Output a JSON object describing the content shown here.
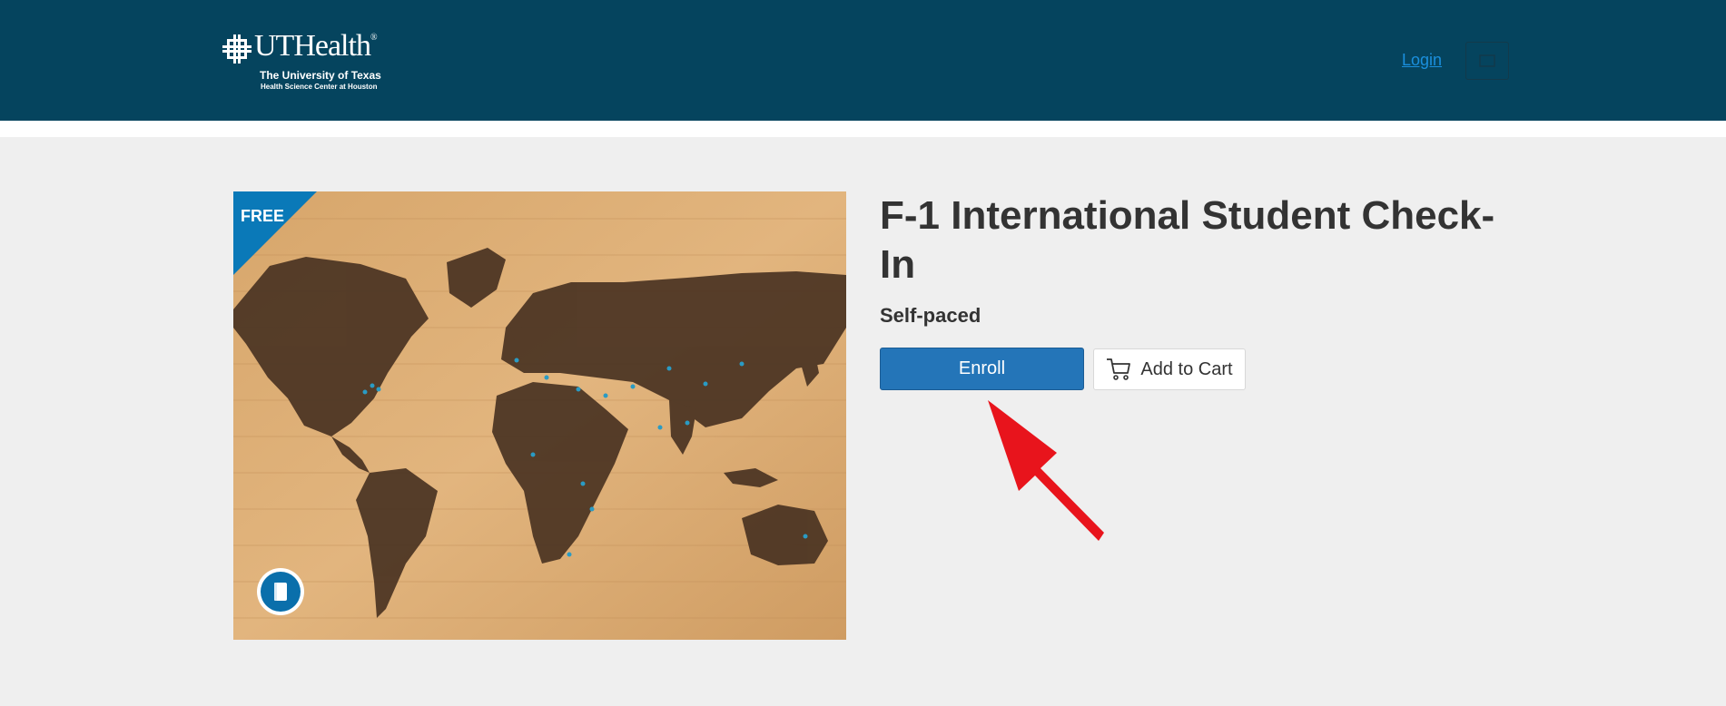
{
  "header": {
    "logo": {
      "word": "UTHealth",
      "reg": "®",
      "line1": "The University of Texas",
      "line2": "Health Science Center at Houston"
    },
    "login_label": "Login",
    "cart_icon": "cart-icon",
    "background": "#05445e"
  },
  "course": {
    "ribbon_label": "FREE",
    "title": "F-1 International Student Check-In",
    "pace": "Self-paced",
    "type_icon": "book-icon"
  },
  "actions": {
    "enroll_label": "Enroll",
    "add_to_cart_label": "Add to Cart",
    "add_to_cart_icon": "cart-icon"
  },
  "colors": {
    "accent": "#2475b8",
    "ribbon": "#0a79b8",
    "annotation_arrow": "#e8141c"
  }
}
